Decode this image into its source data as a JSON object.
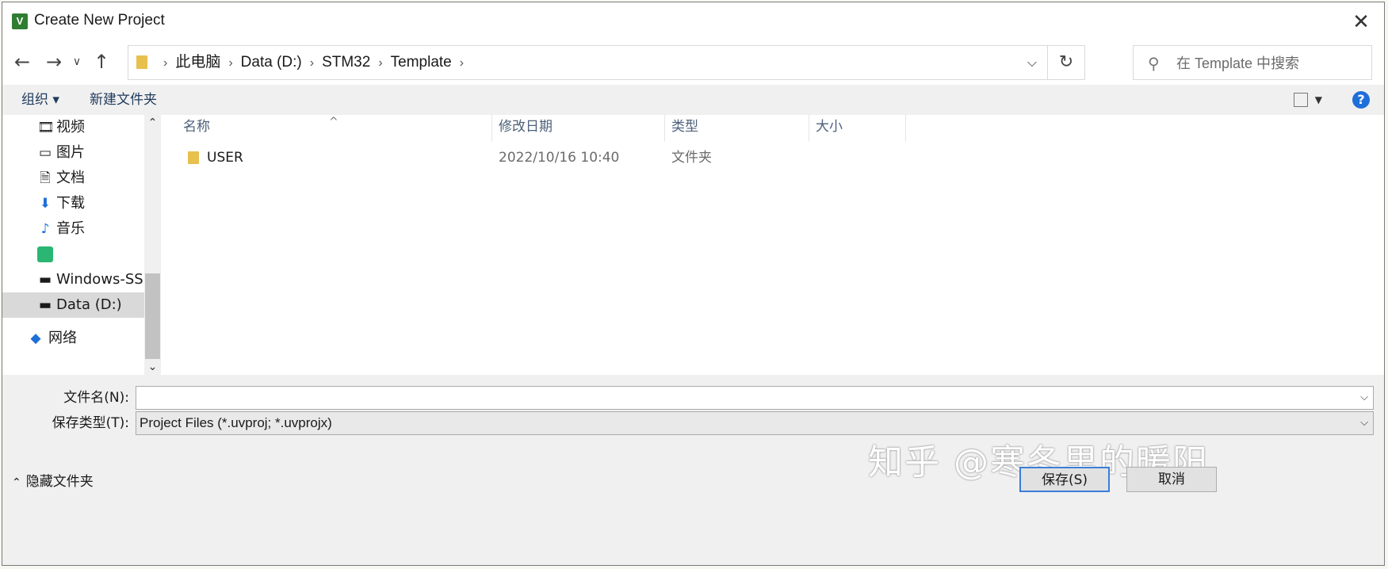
{
  "window": {
    "title": "Create New Project",
    "close": "✕"
  },
  "nav": {
    "back": "←",
    "forward": "→",
    "recent": "∨",
    "up": "↑",
    "breadcrumb": [
      "此电脑",
      "Data (D:)",
      "STM32",
      "Template"
    ],
    "search_placeholder": "在 Template 中搜索"
  },
  "toolbar": {
    "organize": "组织 ▾",
    "new_folder": "新建文件夹",
    "help": "?"
  },
  "sidebar": {
    "items": [
      {
        "label": "视频",
        "icon": "video-icon"
      },
      {
        "label": "图片",
        "icon": "picture-icon"
      },
      {
        "label": "文档",
        "icon": "document-icon"
      },
      {
        "label": "下载",
        "icon": "download-icon"
      },
      {
        "label": "音乐",
        "icon": "music-icon"
      },
      {
        "label": "",
        "icon": "app-icon"
      },
      {
        "label": "Windows-SSD",
        "icon": "drive-icon"
      },
      {
        "label": "Data (D:)",
        "icon": "drive-icon"
      },
      {
        "label": "网络",
        "icon": "network-icon"
      }
    ]
  },
  "columns": {
    "name": "名称",
    "modified": "修改日期",
    "type": "类型",
    "size": "大小"
  },
  "files": [
    {
      "name": "USER",
      "modified": "2022/10/16 10:40",
      "type": "文件夹",
      "size": ""
    }
  ],
  "form": {
    "filename_label": "文件名(N):",
    "filename_value": "",
    "filetype_label": "保存类型(T):",
    "filetype_value": "Project Files (*.uvproj; *.uvprojx)"
  },
  "footer": {
    "hide_folders": "隐藏文件夹",
    "save": "保存(S)",
    "cancel": "取消",
    "watermark": "知乎 @寒冬里的暖阳"
  },
  "colors": {
    "folder": "#e7c04d",
    "help": "#1e6fd9",
    "selection": "#d9d9d9",
    "primary_border": "#3b7dd8"
  }
}
